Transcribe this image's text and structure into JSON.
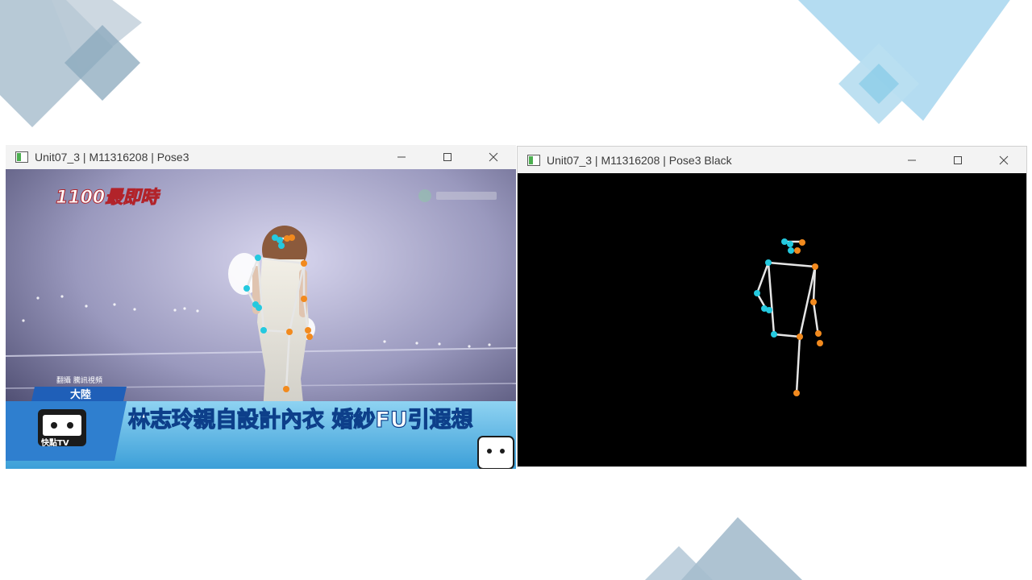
{
  "colors": {
    "slide_bg": "#ffffff",
    "deco_blue_gray": "#9fb7c9",
    "deco_light_blue": "#a9d8ef",
    "keypoint_left": "#24c9df",
    "keypoint_right": "#f28a1e",
    "skeleton_line": "#e6e6e6",
    "ticker_blue": "#1f5fb8"
  },
  "windows": [
    {
      "title": "Unit07_3 | M11316208 | Pose3",
      "content": "video-frame-with-pose-overlay",
      "broadcast": {
        "program_logo": "1100最即時",
        "source_label": "翻攝 騰訊視頻",
        "region_badge": "大陸",
        "headline": "林志玲親自設計內衣 婚紗FU引遐想",
        "channel_logo": "快點TV"
      },
      "controls": [
        "minimize-icon",
        "maximize-icon",
        "close-icon"
      ]
    },
    {
      "title": "Unit07_3 | M11316208 | Pose3 Black",
      "content": "pose-skeleton-on-black",
      "controls": [
        "minimize-icon",
        "maximize-icon",
        "close-icon"
      ]
    }
  ]
}
